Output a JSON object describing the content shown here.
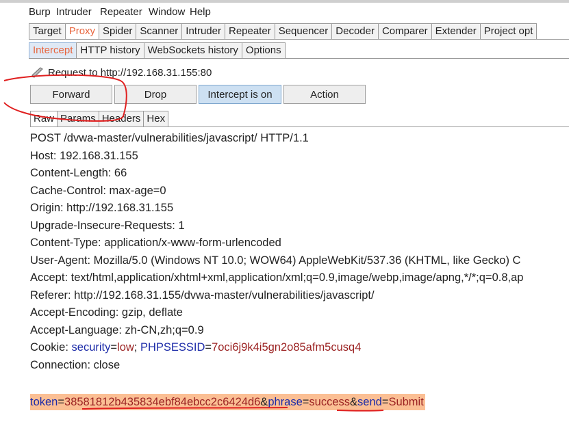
{
  "menubar": {
    "items": [
      "Burp",
      "Intruder",
      "Repeater",
      "Window",
      "Help"
    ]
  },
  "main_tabs": [
    "Target",
    "Proxy",
    "Spider",
    "Scanner",
    "Intruder",
    "Repeater",
    "Sequencer",
    "Decoder",
    "Comparer",
    "Extender",
    "Project opt"
  ],
  "active_main_tab": "Proxy",
  "sub_tabs": [
    "Intercept",
    "HTTP history",
    "WebSockets history",
    "Options"
  ],
  "active_sub_tab": "Intercept",
  "request_line": {
    "icon": "pencil-icon",
    "text": "Request to http://192.168.31.155:80"
  },
  "buttons": {
    "forward": "Forward",
    "drop": "Drop",
    "intercept": "Intercept is on",
    "action": "Action"
  },
  "view_tabs": [
    "Raw",
    "Params",
    "Headers",
    "Hex"
  ],
  "active_view_tab": "Raw",
  "request": {
    "lines": [
      "POST /dvwa-master/vulnerabilities/javascript/ HTTP/1.1",
      "Host: 192.168.31.155",
      "Content-Length: 66",
      "Cache-Control: max-age=0",
      "Origin: http://192.168.31.155",
      "Upgrade-Insecure-Requests: 1",
      "Content-Type: application/x-www-form-urlencoded",
      "User-Agent: Mozilla/5.0 (Windows NT 10.0; WOW64) AppleWebKit/537.36 (KHTML, like Gecko) C",
      "Accept: text/html,application/xhtml+xml,application/xml;q=0.9,image/webp,image/apng,*/*;q=0.8,ap",
      "Referer: http://192.168.31.155/dvwa-master/vulnerabilities/javascript/",
      "Accept-Encoding: gzip, deflate",
      "Accept-Language: zh-CN,zh;q=0.9"
    ],
    "cookie": {
      "label": "Cookie: ",
      "name1": "security",
      "eq1": "=",
      "val1": "low",
      "sep": "; ",
      "name2": "PHPSESSID",
      "eq2": "=",
      "val2": "7oci6j9k4i5gn2o85afm5cusq4"
    },
    "connection": "Connection: close",
    "body": {
      "p1_name": "token",
      "eq": "=",
      "p1_val": "38581812b435834ebf84ebcc2c6424d6",
      "amp": "&",
      "p2_name": "phrase",
      "p2_val": "success",
      "p3_name": "send",
      "p3_val": "Submit"
    }
  },
  "colors": {
    "active_tab": "#e8643c",
    "param_name": "#1c2ba8",
    "param_value": "#9b2222",
    "body_highlight": "#fbbf94",
    "annotation": "#e02020"
  }
}
